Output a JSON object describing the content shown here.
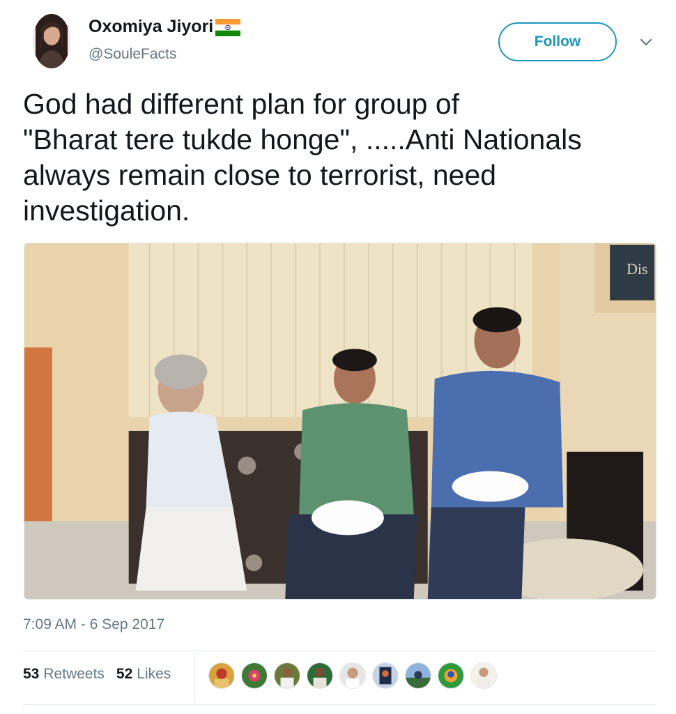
{
  "user": {
    "display_name": "Oxomiya Jiyori",
    "handle": "@SouleFacts",
    "flag_icon": "india-flag-icon"
  },
  "follow_label": "Follow",
  "tweet": {
    "line1": "God had different plan for group of",
    "line2": "\"Bharat tere tukde honge\", .....Anti Nationals",
    "line3": "always remain close to terrorist, need",
    "line4": "investigation."
  },
  "media": {
    "sign_text": "Dis"
  },
  "timestamp": "7:09 AM - 6 Sep 2017",
  "stats": {
    "retweets_count": "53",
    "retweets_label": "Retweets",
    "likes_count": "52",
    "likes_label": "Likes"
  },
  "colors": {
    "accent": "#1b95c0",
    "secondary_text": "#657786",
    "primary_text": "#14171a"
  }
}
